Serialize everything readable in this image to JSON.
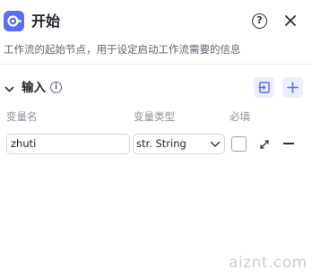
{
  "header": {
    "title": "开始",
    "subtitle": "工作流的起始节点，用于设定启动工作流需要的信息",
    "node_icon": "start-node-icon",
    "help_icon": "question-icon",
    "help_glyph": "?",
    "close_icon": "close-icon"
  },
  "inputs_section": {
    "title": "输入",
    "info_icon": "info-icon",
    "info_glyph": "i",
    "import_icon": "import-icon",
    "add_icon": "plus-icon",
    "columns": {
      "name": "变量名",
      "type": "变量类型",
      "required": "必填"
    },
    "variables": [
      {
        "name": "zhuti",
        "type": "str. String",
        "required": false
      }
    ]
  },
  "watermark": "aiznt.com",
  "colors": {
    "accent": "#5b6cf5",
    "accent_light": "#eceefd",
    "border": "#d4d6da",
    "muted_text": "#8a8f99"
  }
}
